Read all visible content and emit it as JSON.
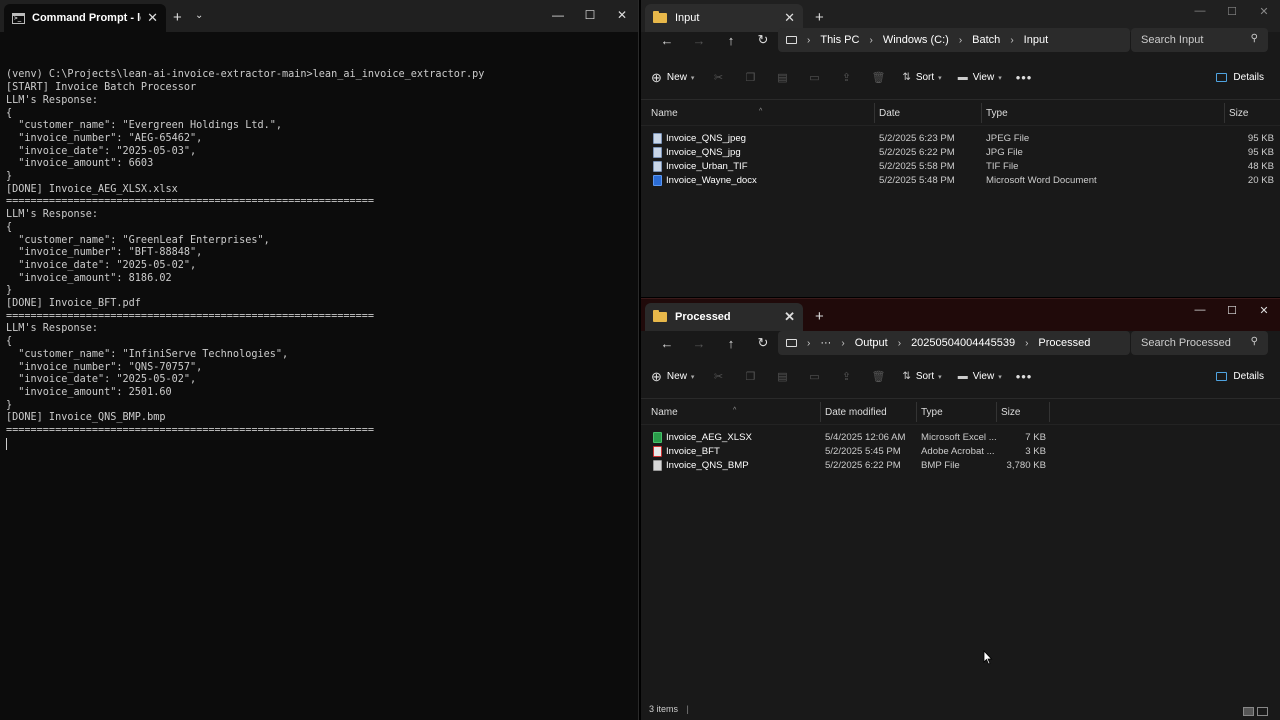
{
  "terminal": {
    "tab_title": "Command Prompt - lean_",
    "new_tab": "+",
    "dropdown": "⌄",
    "controls": {
      "minimize": "—",
      "maximize": "☐",
      "close": "✕"
    },
    "lines": [
      "(venv) C:\\Projects\\lean-ai-invoice-extractor-main>lean_ai_invoice_extractor.py",
      "[START] Invoice Batch Processor",
      "LLM's Response:",
      "{",
      "  \"customer_name\": \"Evergreen Holdings Ltd.\",",
      "  \"invoice_number\": \"AEG-65462\",",
      "  \"invoice_date\": \"2025-05-03\",",
      "  \"invoice_amount\": 6603",
      "}",
      "[DONE] Invoice_AEG_XLSX.xlsx",
      "============================================================",
      "LLM's Response:",
      "{",
      "  \"customer_name\": \"GreenLeaf Enterprises\",",
      "  \"invoice_number\": \"BFT-88848\",",
      "  \"invoice_date\": \"2025-05-02\",",
      "  \"invoice_amount\": 8186.02",
      "}",
      "[DONE] Invoice_BFT.pdf",
      "============================================================",
      "LLM's Response:",
      "{",
      "  \"customer_name\": \"InfiniServe Technologies\",",
      "  \"invoice_number\": \"QNS-70757\",",
      "  \"invoice_date\": \"2025-05-02\",",
      "  \"invoice_amount\": 2501.60",
      "}",
      "[DONE] Invoice_QNS_BMP.bmp",
      "============================================================"
    ]
  },
  "input_explorer": {
    "tab_title": "Input",
    "breadcrumb": [
      "This PC",
      "Windows (C:)",
      "Batch",
      "Input"
    ],
    "search_placeholder": "Search Input",
    "toolbar": {
      "new": "New",
      "sort": "Sort",
      "view": "View",
      "details": "Details",
      "more": "•••"
    },
    "columns": {
      "name": "Name",
      "date": "Date",
      "type": "Type",
      "size": "Size"
    },
    "files": [
      {
        "name": "Invoice_QNS_jpeg",
        "date": "5/2/2025 6:23 PM",
        "type": "JPEG File",
        "size": "95 KB",
        "icon": "image-file-icon"
      },
      {
        "name": "Invoice_QNS_jpg",
        "date": "5/2/2025 6:22 PM",
        "type": "JPG File",
        "size": "95 KB",
        "icon": "image-file-icon"
      },
      {
        "name": "Invoice_Urban_TIF",
        "date": "5/2/2025 5:58 PM",
        "type": "TIF File",
        "size": "48 KB",
        "icon": "image-file-icon"
      },
      {
        "name": "Invoice_Wayne_docx",
        "date": "5/2/2025 5:48 PM",
        "type": "Microsoft Word Document",
        "size": "20 KB",
        "icon": "word-file-icon"
      }
    ]
  },
  "processed_explorer": {
    "tab_title": "Processed",
    "breadcrumb": [
      "Output",
      "20250504004445539",
      "Processed"
    ],
    "search_placeholder": "Search Processed",
    "toolbar": {
      "new": "New",
      "sort": "Sort",
      "view": "View",
      "details": "Details",
      "more": "•••"
    },
    "columns": {
      "name": "Name",
      "date": "Date modified",
      "type": "Type",
      "size": "Size"
    },
    "files": [
      {
        "name": "Invoice_AEG_XLSX",
        "date": "5/4/2025 12:06 AM",
        "type": "Microsoft Excel ...",
        "size": "7 KB",
        "icon": "excel-file-icon"
      },
      {
        "name": "Invoice_BFT",
        "date": "5/2/2025 5:45 PM",
        "type": "Adobe Acrobat ...",
        "size": "3 KB",
        "icon": "pdf-file-icon"
      },
      {
        "name": "Invoice_QNS_BMP",
        "date": "5/2/2025 6:22 PM",
        "type": "BMP File",
        "size": "3,780 KB",
        "icon": "bmp-file-icon"
      }
    ],
    "status": "3 items"
  }
}
